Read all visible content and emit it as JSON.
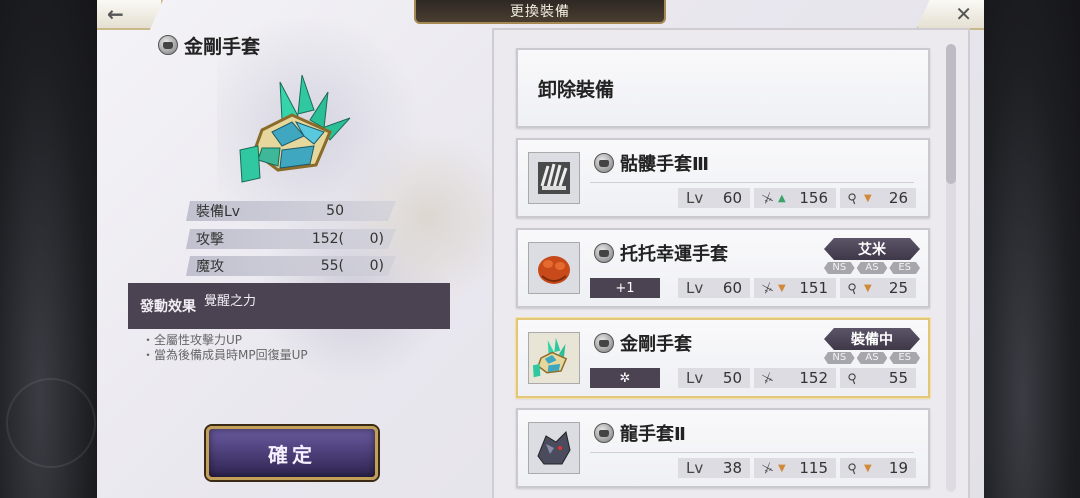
{
  "header": {
    "title": "更換裝備",
    "back_icon": "arrow-left-icon",
    "close_icon": "close-icon"
  },
  "detail": {
    "name": "金剛手套",
    "stats": [
      {
        "key": "裝備Lv",
        "value": "50",
        "paren": ""
      },
      {
        "key": "攻擊",
        "value": "152(",
        "paren": "0)"
      },
      {
        "key": "魔攻",
        "value": "55(",
        "paren": "0)"
      }
    ],
    "effect_label": "發動效果",
    "effect_name": "覺醒之力",
    "effect_desc": [
      "・全屬性攻擊力UP",
      "・當為後備成員時MP回復量UP"
    ],
    "confirm_label": "確定"
  },
  "list": {
    "unequip_label": "卸除裝備",
    "items": [
      {
        "name": "骷髏手套Ⅲ",
        "badge": "",
        "tag": "",
        "slots": [],
        "lv_label": "Lv",
        "lv": "60",
        "atk": "156",
        "atk_trend": "up",
        "mag": "26",
        "mag_trend": "down"
      },
      {
        "name": "托托幸運手套",
        "badge": "+1",
        "tag": "艾米",
        "slots": [
          "NS",
          "AS",
          "ES"
        ],
        "lv_label": "Lv",
        "lv": "60",
        "atk": "151",
        "atk_trend": "down",
        "mag": "25",
        "mag_trend": "down"
      },
      {
        "name": "金剛手套",
        "badge": "✲",
        "tag": "裝備中",
        "slots": [
          "NS",
          "AS",
          "ES"
        ],
        "lv_label": "Lv",
        "lv": "50",
        "atk": "152",
        "atk_trend": "",
        "mag": "55",
        "mag_trend": ""
      },
      {
        "name": "龍手套Ⅱ",
        "badge": "",
        "tag": "",
        "slots": [],
        "lv_label": "Lv",
        "lv": "38",
        "atk": "115",
        "atk_trend": "down",
        "mag": "19",
        "mag_trend": "down"
      }
    ]
  },
  "colors": {
    "accent_dark": "#4b4352",
    "gold": "#c3a05a",
    "up": "#3aa36a",
    "down": "#d28a3a"
  }
}
